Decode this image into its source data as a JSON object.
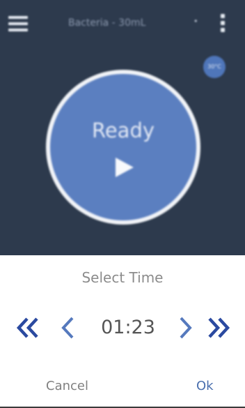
{
  "header": {
    "title": "Bacteria - 30mL",
    "dot": "•",
    "menu_icon": "hamburger-icon",
    "more_icon": "kebab-menu-icon"
  },
  "temperature_badge": {
    "text": "30°C"
  },
  "main": {
    "status_label": "Ready",
    "play_icon": "play-icon"
  },
  "dialog": {
    "title": "Select Time",
    "time_value": "01:23",
    "fast_back_icon": "double-chevron-left-icon",
    "back_icon": "chevron-left-icon",
    "forward_icon": "chevron-right-icon",
    "fast_forward_icon": "double-chevron-right-icon",
    "cancel_label": "Cancel",
    "ok_label": "Ok"
  },
  "colors": {
    "background": "#2d3a4d",
    "accent": "#5b7fc0",
    "dialog_button": "#4a6fae",
    "fast_chevron": "#2b4aa0",
    "chevron": "#5579bd"
  }
}
